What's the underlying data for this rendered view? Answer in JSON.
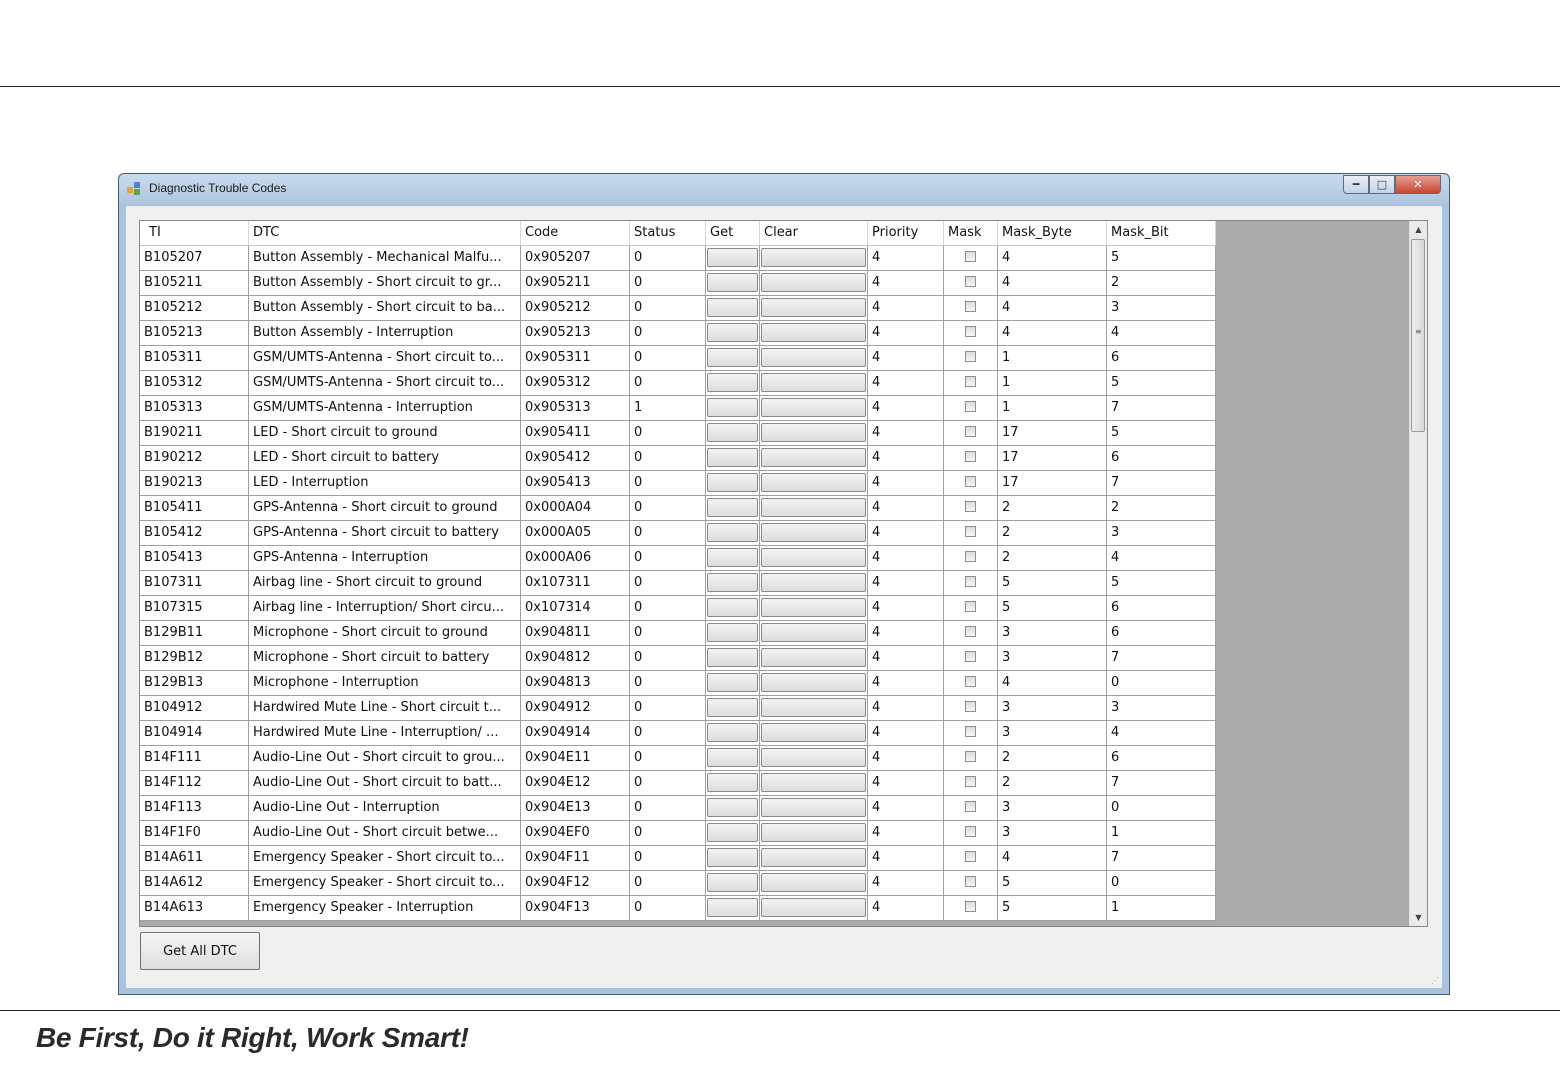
{
  "window": {
    "title": "Diagnostic Trouble Codes"
  },
  "slogan": "Be First, Do it Right, Work Smart!",
  "grid": {
    "columns": [
      "TI",
      "DTC",
      "Code",
      "Status",
      "Get",
      "Clear",
      "Priority",
      "Mask",
      "Mask_Byte",
      "Mask_Bit"
    ],
    "rows": [
      {
        "ti": "B105207",
        "dtc": "Button Assembly - Mechanical Malfu...",
        "code": "0x905207",
        "status": "0",
        "priority": "4",
        "mask_byte": "4",
        "mask_bit": "5"
      },
      {
        "ti": "B105211",
        "dtc": "Button Assembly - Short circuit to gr...",
        "code": "0x905211",
        "status": "0",
        "priority": "4",
        "mask_byte": "4",
        "mask_bit": "2"
      },
      {
        "ti": "B105212",
        "dtc": "Button Assembly - Short circuit to ba...",
        "code": "0x905212",
        "status": "0",
        "priority": "4",
        "mask_byte": "4",
        "mask_bit": "3"
      },
      {
        "ti": "B105213",
        "dtc": "Button Assembly - Interruption",
        "code": "0x905213",
        "status": "0",
        "priority": "4",
        "mask_byte": "4",
        "mask_bit": "4"
      },
      {
        "ti": "B105311",
        "dtc": "GSM/UMTS-Antenna - Short circuit to...",
        "code": "0x905311",
        "status": "0",
        "priority": "4",
        "mask_byte": "1",
        "mask_bit": "6"
      },
      {
        "ti": "B105312",
        "dtc": "GSM/UMTS-Antenna - Short circuit to...",
        "code": "0x905312",
        "status": "0",
        "priority": "4",
        "mask_byte": "1",
        "mask_bit": "5"
      },
      {
        "ti": "B105313",
        "dtc": "GSM/UMTS-Antenna - Interruption",
        "code": "0x905313",
        "status": "1",
        "priority": "4",
        "mask_byte": "1",
        "mask_bit": "7"
      },
      {
        "ti": "B190211",
        "dtc": "LED - Short circuit to ground",
        "code": "0x905411",
        "status": "0",
        "priority": "4",
        "mask_byte": "17",
        "mask_bit": "5"
      },
      {
        "ti": "B190212",
        "dtc": "LED - Short circuit to battery",
        "code": "0x905412",
        "status": "0",
        "priority": "4",
        "mask_byte": "17",
        "mask_bit": "6"
      },
      {
        "ti": "B190213",
        "dtc": "LED - Interruption",
        "code": "0x905413",
        "status": "0",
        "priority": "4",
        "mask_byte": "17",
        "mask_bit": "7"
      },
      {
        "ti": "B105411",
        "dtc": "GPS-Antenna - Short circuit to ground",
        "code": "0x000A04",
        "status": "0",
        "priority": "4",
        "mask_byte": "2",
        "mask_bit": "2"
      },
      {
        "ti": "B105412",
        "dtc": "GPS-Antenna - Short circuit to battery",
        "code": "0x000A05",
        "status": "0",
        "priority": "4",
        "mask_byte": "2",
        "mask_bit": "3"
      },
      {
        "ti": "B105413",
        "dtc": "GPS-Antenna - Interruption",
        "code": "0x000A06",
        "status": "0",
        "priority": "4",
        "mask_byte": "2",
        "mask_bit": "4"
      },
      {
        "ti": "B107311",
        "dtc": "Airbag line - Short circuit to ground",
        "code": "0x107311",
        "status": "0",
        "priority": "4",
        "mask_byte": "5",
        "mask_bit": "5"
      },
      {
        "ti": "B107315",
        "dtc": "Airbag line - Interruption/ Short circu...",
        "code": "0x107314",
        "status": "0",
        "priority": "4",
        "mask_byte": "5",
        "mask_bit": "6"
      },
      {
        "ti": "B129B11",
        "dtc": "Microphone - Short circuit to ground",
        "code": "0x904811",
        "status": "0",
        "priority": "4",
        "mask_byte": "3",
        "mask_bit": "6"
      },
      {
        "ti": "B129B12",
        "dtc": "Microphone - Short circuit to battery",
        "code": "0x904812",
        "status": "0",
        "priority": "4",
        "mask_byte": "3",
        "mask_bit": "7"
      },
      {
        "ti": "B129B13",
        "dtc": "Microphone - Interruption",
        "code": "0x904813",
        "status": "0",
        "priority": "4",
        "mask_byte": "4",
        "mask_bit": "0"
      },
      {
        "ti": "B104912",
        "dtc": "Hardwired Mute Line - Short circuit t...",
        "code": "0x904912",
        "status": "0",
        "priority": "4",
        "mask_byte": "3",
        "mask_bit": "3"
      },
      {
        "ti": "B104914",
        "dtc": "Hardwired Mute Line - Interruption/ ...",
        "code": "0x904914",
        "status": "0",
        "priority": "4",
        "mask_byte": "3",
        "mask_bit": "4"
      },
      {
        "ti": "B14F111",
        "dtc": "Audio-Line Out - Short circuit to grou...",
        "code": "0x904E11",
        "status": "0",
        "priority": "4",
        "mask_byte": "2",
        "mask_bit": "6"
      },
      {
        "ti": "B14F112",
        "dtc": "Audio-Line Out - Short circuit to batt...",
        "code": "0x904E12",
        "status": "0",
        "priority": "4",
        "mask_byte": "2",
        "mask_bit": "7"
      },
      {
        "ti": "B14F113",
        "dtc": "Audio-Line Out - Interruption",
        "code": "0x904E13",
        "status": "0",
        "priority": "4",
        "mask_byte": "3",
        "mask_bit": "0"
      },
      {
        "ti": "B14F1F0",
        "dtc": "Audio-Line Out - Short circuit betwe...",
        "code": "0x904EF0",
        "status": "0",
        "priority": "4",
        "mask_byte": "3",
        "mask_bit": "1"
      },
      {
        "ti": "B14A611",
        "dtc": "Emergency Speaker - Short circuit to...",
        "code": "0x904F11",
        "status": "0",
        "priority": "4",
        "mask_byte": "4",
        "mask_bit": "7"
      },
      {
        "ti": "B14A612",
        "dtc": "Emergency Speaker - Short circuit to...",
        "code": "0x904F12",
        "status": "0",
        "priority": "4",
        "mask_byte": "5",
        "mask_bit": "0"
      },
      {
        "ti": "B14A613",
        "dtc": "Emergency Speaker - Interruption",
        "code": "0x904F13",
        "status": "0",
        "priority": "4",
        "mask_byte": "5",
        "mask_bit": "1"
      }
    ]
  },
  "buttons": {
    "get_all": "Get All DTC"
  },
  "icons": {
    "app": "app-window-icon",
    "minimize": "minimize-icon",
    "maximize": "maximize-icon",
    "close": "close-icon",
    "scroll_up": "scroll-up-arrow-icon",
    "scroll_down": "scroll-down-arrow-icon",
    "size_grip": "resize-grip-icon"
  },
  "colors": {
    "title_bar": "#aec6df",
    "close_button": "#c64532",
    "grid_empty_area": "#ababab",
    "client_bg": "#f0f0f0"
  }
}
